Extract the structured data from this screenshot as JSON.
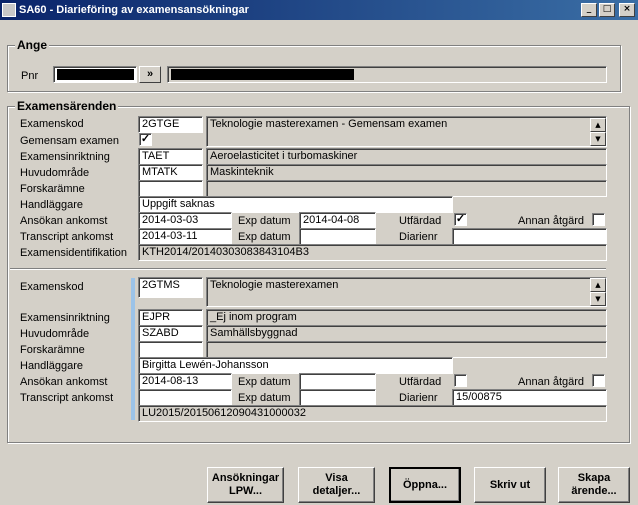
{
  "window": {
    "title": "SA60 - Diarieföring av examensansökningar",
    "minimize": "_",
    "maximize": "□",
    "close": "×"
  },
  "ange": {
    "legend": "Ange",
    "pnr_label": "Pnr",
    "pnr_button": "»",
    "pnr_value": "",
    "name_value": ""
  },
  "arenden": {
    "legend": "Examensärenden",
    "labels": {
      "examenskod": "Examenskod",
      "gemensam": "Gemensam examen",
      "inriktning": "Examensinriktning",
      "huvudomrade": "Huvudområde",
      "forskaramne": "Forskarämne",
      "handlaggare": "Handläggare",
      "ansokan": "Ansökan ankomst",
      "transcript": "Transcript ankomst",
      "examensid": "Examensidentifikation",
      "exp_datum": "Exp datum",
      "utfardad": "Utfärdad",
      "annan": "Annan åtgärd",
      "diarienr": "Diarienr"
    },
    "case1": {
      "kod": "2GTGE",
      "kod_text": "Teknologie masterexamen - Gemensam examen",
      "gemensam_checked": "✓",
      "inriktning_kod": "TAET",
      "inriktning_text": "Aeroelasticitet i turbomaskiner",
      "huvud_kod": "MTATK",
      "huvud_text": "Maskinteknik",
      "handlaggare": "Uppgift saknas",
      "ansokan": "2014-03-03",
      "exp_datum_1": "2014-04-08",
      "utfardad_checked": "✓",
      "transcript": "2014-03-11",
      "exp_datum_2": "",
      "diarienr": "",
      "examensid": "KTH2014/20140303083843104B3"
    },
    "case2": {
      "kod": "2GTMS",
      "kod_text": "Teknologie masterexamen",
      "inriktning_kod": "EJPR",
      "inriktning_text": "_Ej inom program",
      "huvud_kod": "SZABD",
      "huvud_text": "Samhällsbyggnad",
      "handlaggare": "Birgitta Lewén-Johansson",
      "ansokan": "2014-08-13",
      "diarienr": "15/00875",
      "examensid": "LU2015/20150612090431000032"
    }
  },
  "buttons": {
    "ansokningar": [
      "Ansökningar",
      "LPW..."
    ],
    "visa": [
      "Visa",
      "detaljer..."
    ],
    "oppna": "Öppna...",
    "skriv": "Skriv ut",
    "skapa": [
      "Skapa",
      "ärende..."
    ]
  },
  "scroll": {
    "up": "▲",
    "down": "▼"
  }
}
